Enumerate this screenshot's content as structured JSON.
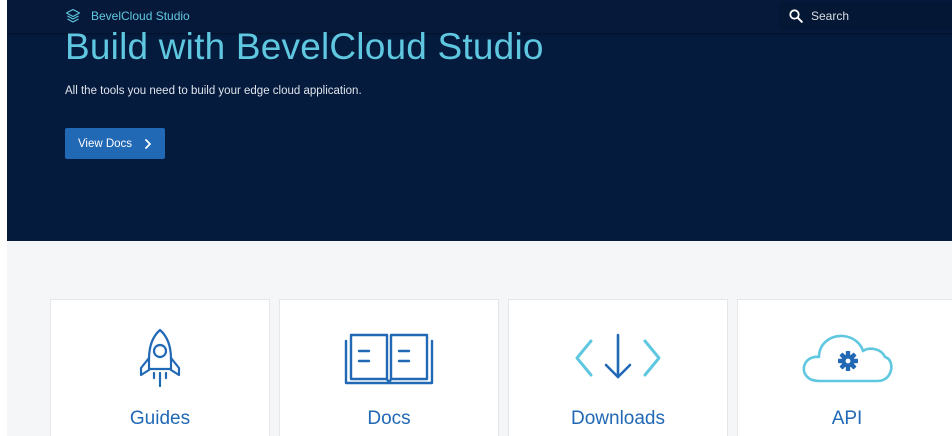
{
  "header": {
    "brand_name": "BevelCloud Studio",
    "brand_icon": "layers-icon",
    "search": {
      "placeholder": "Search",
      "value": "",
      "icon": "search-icon"
    }
  },
  "hero": {
    "title": "Build with BevelCloud Studio",
    "subtitle": "All the tools you need to build your edge cloud application.",
    "cta_label": "View Docs",
    "cta_icon": "chevron-right-icon"
  },
  "cards": [
    {
      "label": "Guides",
      "icon": "rocket-icon"
    },
    {
      "label": "Docs",
      "icon": "open-book-icon"
    },
    {
      "label": "Downloads",
      "icon": "download-icon"
    },
    {
      "label": "API",
      "icon": "cloud-gear-icon"
    }
  ],
  "colors": {
    "hero_background": "#051b3d",
    "accent_teal": "#5fc8e0",
    "button_blue": "#2168b5",
    "page_background": "#f5f6f7"
  }
}
